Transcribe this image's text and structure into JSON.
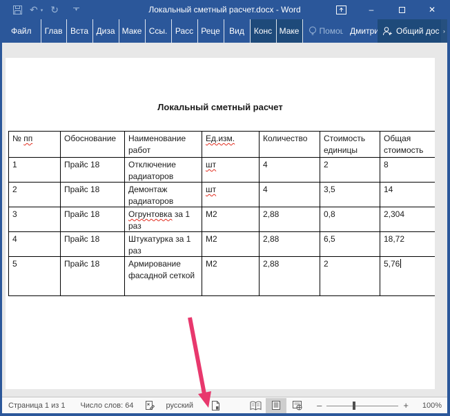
{
  "window": {
    "title": "Локальный сметный расчет.docx - Word",
    "qat": {
      "undo_glyph": "↶",
      "redo_glyph": "↻",
      "dropdown_glyph": "▾"
    },
    "controls": {
      "minimize_glyph": "–",
      "close_glyph": "✕"
    }
  },
  "ribbon": {
    "file_tab": "Файл",
    "tabs": [
      {
        "label": "Глав",
        "contextual": false
      },
      {
        "label": "Вста",
        "contextual": false
      },
      {
        "label": "Диза",
        "contextual": false
      },
      {
        "label": "Маке",
        "contextual": false
      },
      {
        "label": "Ссы.",
        "contextual": false
      },
      {
        "label": "Расс",
        "contextual": false
      },
      {
        "label": "Реце",
        "contextual": false
      },
      {
        "label": "Вид",
        "contextual": false
      },
      {
        "label": "Конс",
        "contextual": true
      },
      {
        "label": "Маке",
        "contextual": true
      }
    ],
    "tell_me": "Помощь",
    "user_name": "Дмитрие...",
    "share_label": "Общий дос",
    "overflow_glyph": "›"
  },
  "document": {
    "title": "Локальный сметный расчет",
    "misspelled": [
      "пп",
      "Ед.изм.",
      "шт",
      "Огрунтовка"
    ],
    "caret_after": "5,76",
    "table": {
      "headers": [
        "№ пп",
        "Обоснование",
        "Наименование работ",
        "Ед.изм.",
        "Количество",
        "Стоимость единицы",
        "Общая стоимость"
      ],
      "rows": [
        [
          "1",
          "Прайс 18",
          "Отключение радиаторов",
          "шт",
          "4",
          "2",
          "8"
        ],
        [
          "2",
          "Прайс 18",
          "Демонтаж радиаторов",
          "шт",
          "4",
          "3,5",
          "14"
        ],
        [
          "3",
          "Прайс 18",
          "Огрунтовка за 1 раз",
          "М2",
          "2,88",
          "0,8",
          "2,304"
        ],
        [
          "4",
          "Прайс 18",
          "Штукатурка за 1 раз",
          "М2",
          "2,88",
          "6,5",
          "18,72"
        ],
        [
          "5",
          "Прайс 18",
          "Армирование фасадной сеткой",
          "М2",
          "2,88",
          "2",
          "5,76"
        ]
      ]
    }
  },
  "status_bar": {
    "page_indicator": "Страница 1 из 1",
    "word_count": "Число слов: 64",
    "language": "русский",
    "zoom_out_glyph": "–",
    "zoom_in_glyph": "+",
    "zoom_level": "100%"
  },
  "colors": {
    "titlebar_blue": "#2b579a",
    "contextual_tab_blue": "#1e4a7a",
    "annotation_arrow": "#e8386d",
    "misspell_red": "#e22c1e"
  }
}
